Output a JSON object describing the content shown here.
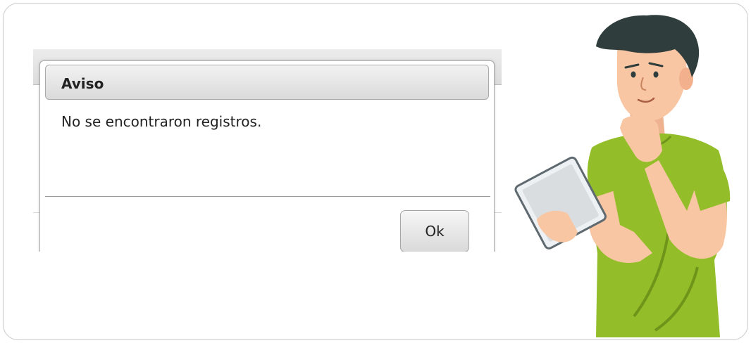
{
  "dialog": {
    "title": "Aviso",
    "message": "No se encontraron registros.",
    "ok_label": "Ok"
  },
  "colors": {
    "shirt": "#93be2a",
    "skin": "#f9c6a3",
    "hair": "#2f3d3d",
    "tablet": "#d9dde0"
  },
  "illustration": {
    "icon": "person-thinking-with-tablet"
  }
}
